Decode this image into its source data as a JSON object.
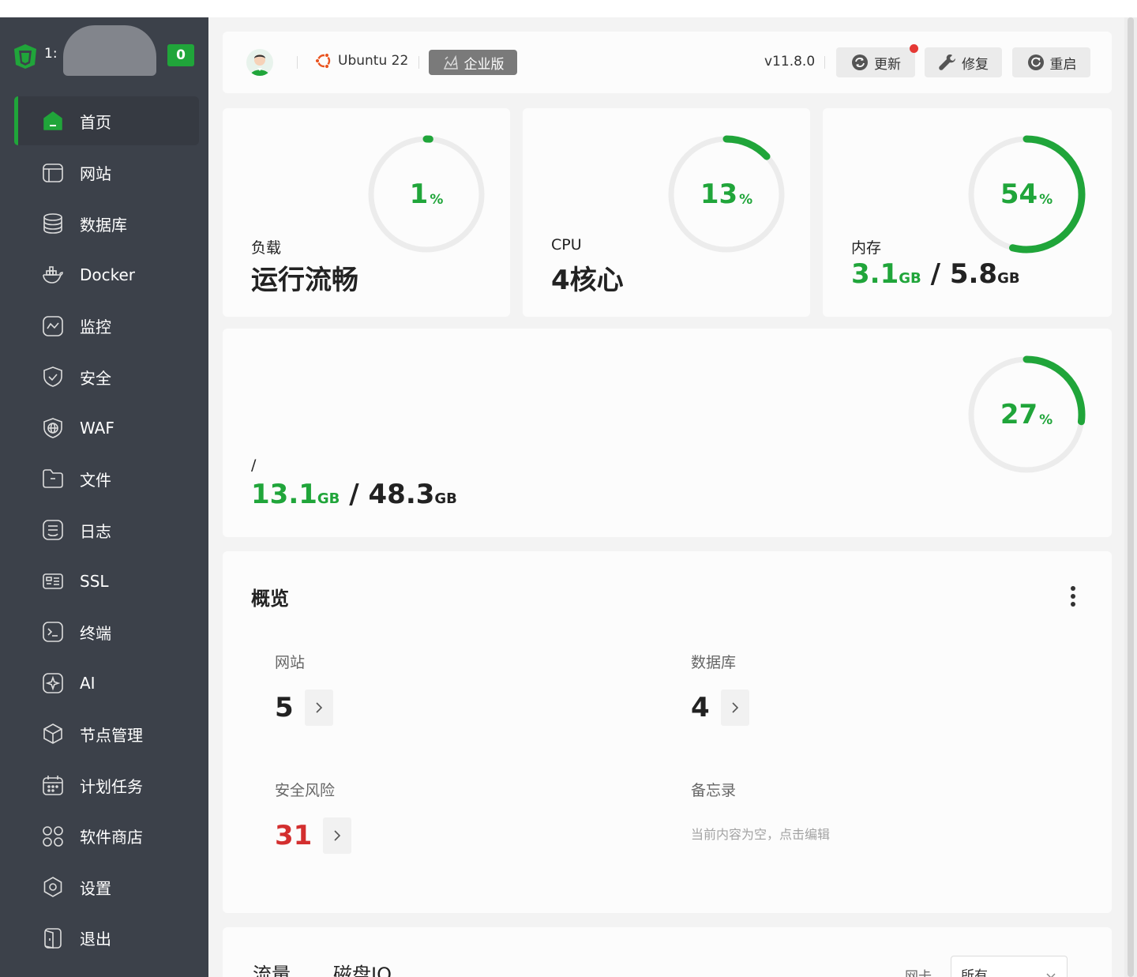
{
  "sidebar": {
    "host": "1:",
    "badge": "0",
    "items": [
      {
        "label": "首页",
        "icon": "home-icon"
      },
      {
        "label": "网站",
        "icon": "website-icon"
      },
      {
        "label": "数据库",
        "icon": "database-icon"
      },
      {
        "label": "Docker",
        "icon": "docker-icon"
      },
      {
        "label": "监控",
        "icon": "monitor-icon"
      },
      {
        "label": "安全",
        "icon": "shield-icon"
      },
      {
        "label": "WAF",
        "icon": "waf-icon"
      },
      {
        "label": "文件",
        "icon": "folder-icon"
      },
      {
        "label": "日志",
        "icon": "log-icon"
      },
      {
        "label": "SSL",
        "icon": "ssl-icon"
      },
      {
        "label": "终端",
        "icon": "terminal-icon"
      },
      {
        "label": "AI",
        "icon": "ai-icon"
      },
      {
        "label": "节点管理",
        "icon": "node-icon"
      },
      {
        "label": "计划任务",
        "icon": "calendar-icon"
      },
      {
        "label": "软件商店",
        "icon": "app-store-icon"
      },
      {
        "label": "设置",
        "icon": "settings-icon"
      },
      {
        "label": "退出",
        "icon": "logout-icon"
      }
    ]
  },
  "header": {
    "os": "Ubuntu 22",
    "edition": "企业版",
    "version": "v11.8.0",
    "update_label": "更新",
    "repair_label": "修复",
    "restart_label": "重启"
  },
  "stats": {
    "load": {
      "label": "负载",
      "status": "运行流畅",
      "percent": 1,
      "pct_text": "1"
    },
    "cpu": {
      "label": "CPU",
      "cores": "4核心",
      "percent": 13,
      "pct_text": "13"
    },
    "memory": {
      "label": "内存",
      "used": "3.1",
      "total": "5.8",
      "unit": "GB",
      "percent": 54,
      "pct_text": "54"
    },
    "disk": {
      "label": "/",
      "used": "13.1",
      "total": "48.3",
      "unit": "GB",
      "percent": 27,
      "pct_text": "27"
    },
    "pct_unit": "%"
  },
  "overview": {
    "title": "概览",
    "website": {
      "label": "网站",
      "value": "5"
    },
    "database": {
      "label": "数据库",
      "value": "4"
    },
    "risk": {
      "label": "安全风险",
      "value": "31"
    },
    "memo": {
      "label": "备忘录",
      "empty_text": "当前内容为空，点击编辑"
    }
  },
  "traffic": {
    "tab_traffic": "流量",
    "tab_diskio": "磁盘IO",
    "nic_label": "网卡",
    "nic_value": "所有"
  },
  "colors": {
    "accent": "#20a53a",
    "sidebar": "#3c414a",
    "danger": "#d32f2f"
  }
}
